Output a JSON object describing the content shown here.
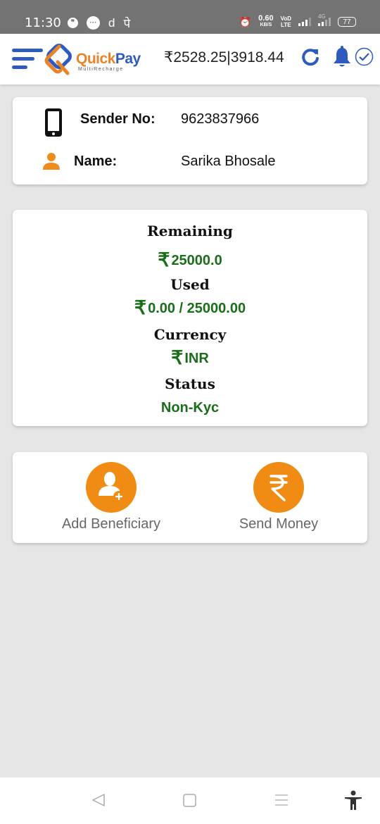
{
  "status_bar": {
    "time": "11:30",
    "notification_icons": [
      "chat-bubble-icon",
      "message-icon",
      "d-app-icon",
      "pe-app-icon"
    ],
    "pe_glyph": "पे",
    "d_glyph": "d",
    "network_speed": "0.60",
    "network_speed_unit": "KB/S",
    "volte_top": "VoD",
    "volte_bottom": "LTE",
    "network_type": "4G",
    "battery": "77"
  },
  "app_bar": {
    "logo_text_1": "Quick",
    "logo_text_2": "Pay",
    "logo_subtitle": "MultiRecharge",
    "balance": "₹2528.25|3918.44",
    "colors": {
      "brand_blue": "#2e5bbd",
      "brand_orange": "#e9832a"
    }
  },
  "sender": {
    "sender_no_label": "Sender No:",
    "sender_no_value": "9623837966",
    "name_label": "Name:",
    "name_value": "Sarika Bhosale"
  },
  "limits": {
    "remaining_label": "Remaining",
    "remaining_value": "25000.0",
    "used_label": "Used",
    "used_value": "0.00 / 25000.00",
    "currency_label": "Currency",
    "currency_value": "INR",
    "status_label": "Status",
    "status_value": "Non-Kyc",
    "rupee_symbol": "₹",
    "value_color": "#1a6e1a"
  },
  "actions": {
    "add_beneficiary_label": "Add Beneficiary",
    "send_money_label": "Send Money",
    "icon_color": "#f08c14"
  }
}
